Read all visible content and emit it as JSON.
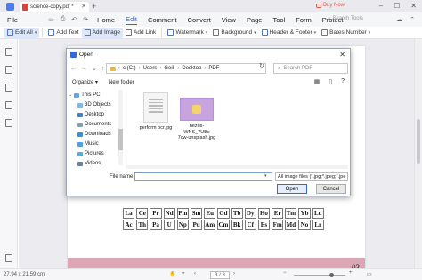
{
  "titlebar": {
    "tab_title": "science-copy.pdf *",
    "buy_now": "Buy Now"
  },
  "menubar": {
    "file": "File",
    "items": [
      "Home",
      "Edit",
      "Comment",
      "Convert",
      "View",
      "Page",
      "Tool",
      "Form",
      "Protect"
    ],
    "active": "Edit",
    "search_placeholder": "Search Tools"
  },
  "toolbar": {
    "edit_all": "Edit All",
    "add_text": "Add Text",
    "add_image": "Add Image",
    "add_link": "Add Link",
    "watermark": "Watermark",
    "background": "Background",
    "header_footer": "Header & Footer",
    "bates_number": "Bates Number"
  },
  "dialog": {
    "title": "Open",
    "path": [
      "c (C:)",
      "Users",
      "Geili",
      "Desktop",
      "PDF"
    ],
    "search_placeholder": "Search PDF",
    "organize": "Organize",
    "new_folder": "New folder",
    "nav_items": [
      "This PC",
      "3D Objects",
      "Desktop",
      "Documents",
      "Downloads",
      "Music",
      "Pictures",
      "Videos"
    ],
    "files": [
      {
        "name": "perform ocr.jpg"
      },
      {
        "name": "nezos-WNS_7UBc\n7cw-unsplash.jpg"
      }
    ],
    "file_name_label": "File name:",
    "file_name_value": "",
    "file_type": "All image files (*.jpg;*.jpeg;*.jpe",
    "open_label": "Open",
    "cancel_label": "Cancel"
  },
  "page": {
    "periodic_row1": [
      "La",
      "Ce",
      "Pr",
      "Nd",
      "Pm",
      "Sm",
      "Eu",
      "Gd",
      "Tb",
      "Dy",
      "Ho",
      "Er",
      "Tm",
      "Yb",
      "Lu",
      ""
    ],
    "periodic_row2": [
      "Ac",
      "Th",
      "Pa",
      "U",
      "Np",
      "Pu",
      "Am",
      "Cm",
      "Bk",
      "Cf",
      "Es",
      "Fm",
      "Md",
      "No",
      "Lr",
      ""
    ],
    "page_number": "03"
  },
  "statusbar": {
    "dimensions": "27.94 x 21.59 cm",
    "page_indicator": "3 / 3"
  }
}
